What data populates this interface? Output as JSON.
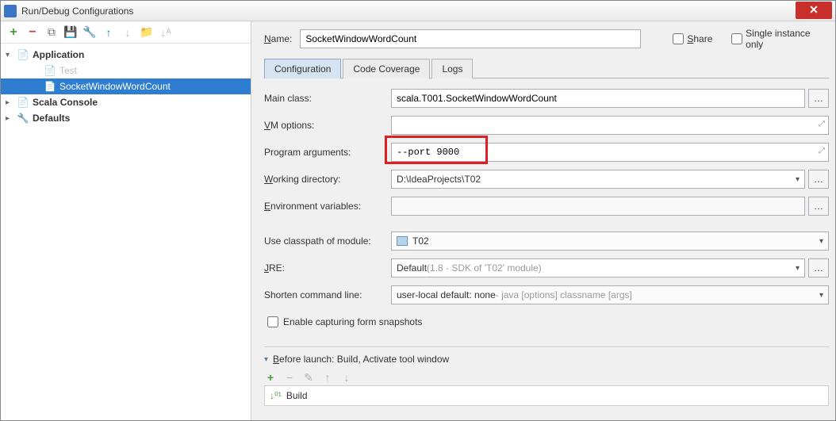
{
  "window": {
    "title": "Run/Debug Configurations"
  },
  "tree": {
    "application": "Application",
    "test": "Test",
    "swwc": "SocketWindowWordCount",
    "scala_console": "Scala Console",
    "defaults": "Defaults"
  },
  "top": {
    "name_label": "Name:",
    "name_value": "SocketWindowWordCount",
    "share": "Share",
    "single_instance": "Single instance only"
  },
  "tabs": {
    "config": "Configuration",
    "coverage": "Code Coverage",
    "logs": "Logs"
  },
  "form": {
    "main_class_label": "Main class:",
    "main_class_value": "scala.T001.SocketWindowWordCount",
    "vm_label": "VM options:",
    "vm_value": "",
    "args_label": "Program arguments:",
    "args_value": "--port 9000",
    "wd_label": "Working directory:",
    "wd_value": "D:\\IdeaProjects\\T02",
    "env_label": "Environment variables:",
    "env_value": "",
    "classpath_label": "Use classpath of module:",
    "classpath_value": "T02",
    "jre_label": "JRE:",
    "jre_value": "Default",
    "jre_hint": " (1.8 - SDK of 'T02' module)",
    "shorten_label": "Shorten command line:",
    "shorten_value": "user-local default: none",
    "shorten_hint": " - java [options] classname [args]",
    "snapshot_label": "Enable capturing form snapshots"
  },
  "before": {
    "header": "Before launch: Build, Activate tool window",
    "build": "Build"
  }
}
